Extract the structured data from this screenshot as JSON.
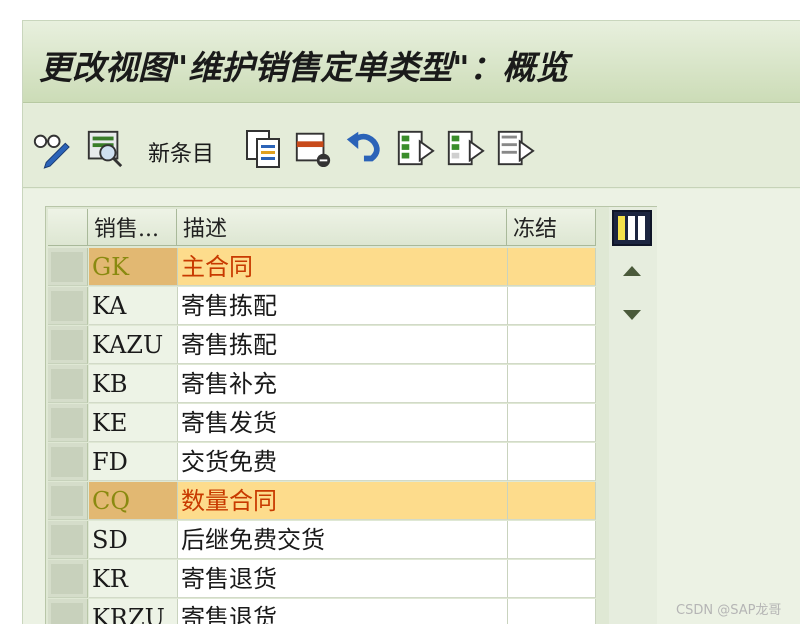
{
  "title": "更改视图\"维护销售定单类型\"：概览",
  "toolbar": {
    "new_entries_label": "新条目",
    "icons": [
      "display-change-icon",
      "select-icon",
      "copy-icon",
      "delete-icon",
      "undo-icon",
      "select-all-icon",
      "select-block-icon",
      "deselect-all-icon"
    ]
  },
  "table": {
    "columns": [
      "销售...",
      "描述",
      "冻结"
    ],
    "rows": [
      {
        "code": "GK",
        "desc": "主合同",
        "frozen": "",
        "highlighted": true
      },
      {
        "code": "KA",
        "desc": "寄售拣配",
        "frozen": "",
        "highlighted": false
      },
      {
        "code": "KAZU",
        "desc": "寄售拣配",
        "frozen": "",
        "highlighted": false
      },
      {
        "code": "KB",
        "desc": "寄售补充",
        "frozen": "",
        "highlighted": false
      },
      {
        "code": "KE",
        "desc": "寄售发货",
        "frozen": "",
        "highlighted": false
      },
      {
        "code": "FD",
        "desc": "交货免费",
        "frozen": "",
        "highlighted": false
      },
      {
        "code": "CQ",
        "desc": "数量合同",
        "frozen": "",
        "highlighted": true
      },
      {
        "code": "SD",
        "desc": "后继免费交货",
        "frozen": "",
        "highlighted": false
      },
      {
        "code": "KR",
        "desc": "寄售退货",
        "frozen": "",
        "highlighted": false
      },
      {
        "code": "KRZU",
        "desc": "寄售退货",
        "frozen": "",
        "highlighted": false
      }
    ]
  },
  "colors": {
    "highlight_row": "#fddc8c",
    "highlight_code": "#e2b872",
    "highlight_text": "#c83a00",
    "title_bar": "#ccdcb7"
  },
  "watermark": "CSDN @SAP龙哥"
}
